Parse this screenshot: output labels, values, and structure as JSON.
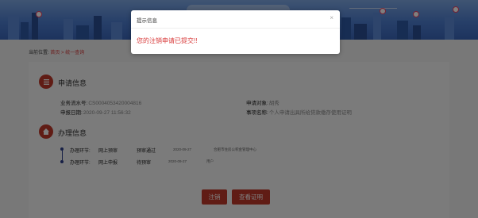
{
  "breadcrumb": {
    "label": "当前位置:",
    "home": "首页",
    "sep": " > ",
    "current": "统一查询"
  },
  "apply_section": {
    "title": "申请信息",
    "serial_label": "业务流水号:",
    "serial_value": "CS0004053420004816",
    "date_label": "申报日期:",
    "date_value": "2020-09-27 11:56:32",
    "target_label": "申请对象:",
    "target_value": "胡秀",
    "matter_label": "事项名称:",
    "matter_value": "个人申请出具所给贷款缴存使用证明"
  },
  "process_section": {
    "title": "办理信息",
    "steps": [
      {
        "stage_label": "办理环节:",
        "stage": "网上预审",
        "status": "预审通过",
        "date": "2020-09-27",
        "handler": "合肥市住房公积金管理中心"
      },
      {
        "stage_label": "办理环节:",
        "stage": "网上申报",
        "status": "待预审",
        "date": "2020-09-27",
        "handler": "用户"
      }
    ]
  },
  "buttons": {
    "cancel": "注销",
    "view_cert": "查看证明"
  },
  "dialog": {
    "title": "提示信息",
    "close": "×",
    "message": "您的注销申请已提交!!"
  },
  "colors": {
    "accent": "#c0392b",
    "link": "#d83a3a",
    "timeline": "#2d3e8a"
  }
}
